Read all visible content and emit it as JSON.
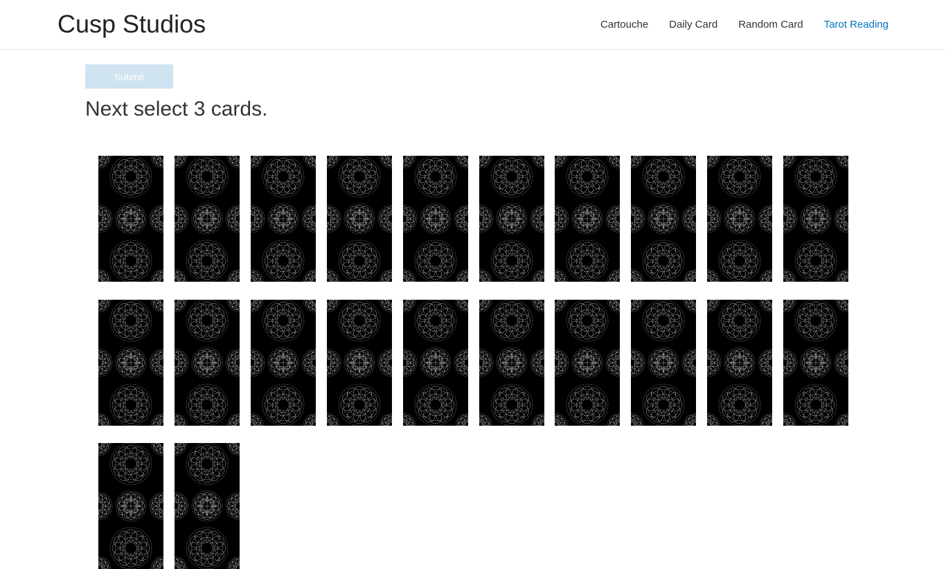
{
  "header": {
    "brand": "Cusp Studios",
    "nav": [
      {
        "label": "Cartouche",
        "active": false
      },
      {
        "label": "Daily Card",
        "active": false
      },
      {
        "label": "Random Card",
        "active": false
      },
      {
        "label": "Tarot Reading",
        "active": true
      }
    ]
  },
  "main": {
    "submit_label": "Submit",
    "submit_disabled": true,
    "instruction": "Next select 3 cards."
  },
  "deck": {
    "card_count": 22,
    "card_back": "mandala-pattern"
  },
  "colors": {
    "accent": "#0274be",
    "submit_disabled_bg": "#cfe3f1",
    "card_back_bg": "#000000",
    "card_back_line": "#d9d9d9"
  }
}
